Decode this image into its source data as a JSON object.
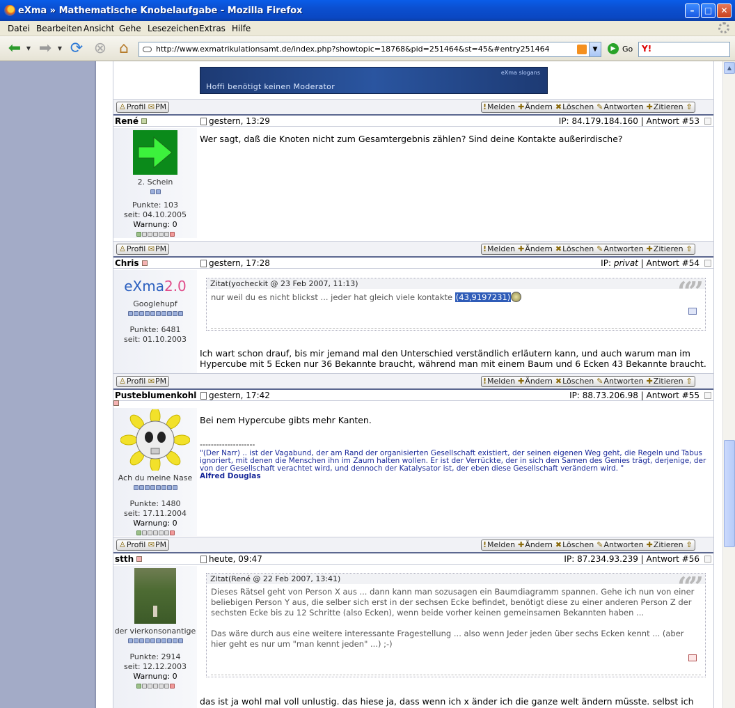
{
  "window": {
    "title": "eXma » Mathematische Knobelaufgabe - Mozilla Firefox"
  },
  "menu": [
    "Datei",
    "Bearbeiten",
    "Ansicht",
    "Gehe",
    "Lesezeichen",
    "Extras",
    "Hilfe"
  ],
  "nav": {
    "url": "http://www.exmatrikulationsamt.de/index.php?showtopic=18768&pid=251464&st=45&#entry251464",
    "go_label": "Go"
  },
  "banner": {
    "tag": "eXma slogans",
    "slogan": "Hoffi benötigt keinen Moderator"
  },
  "buttons": {
    "profil": "Profil",
    "pm": "PM",
    "melden": "Melden",
    "aendern": "Ändern",
    "loeschen": "Löschen",
    "antworten": "Antworten",
    "zitieren": "Zitieren"
  },
  "posts": [
    {
      "author": "René",
      "date": "gestern, 13:29",
      "ip_label": "IP:",
      "ip": "84.179.184.160",
      "answer": "Antwort #53",
      "rank": "2. Schein",
      "points": "Punkte: 103",
      "since": "seit: 04.10.2005",
      "warning": "Warnung: 0",
      "text": "Wer sagt, daß die Knoten nicht zum Gesamtergebnis zählen? Sind deine Kontakte außerirdische?"
    },
    {
      "author": "Chris",
      "date": "gestern, 17:28",
      "ip_label": "IP:",
      "ip": "privat",
      "answer": "Antwort #54",
      "logo_a": "eXma",
      "logo_b": "2.0",
      "rank": "Googlehupf",
      "points": "Punkte: 6481",
      "since": "seit: 01.10.2003",
      "quote_head": "Zitat(yocheckit @ 23 Feb 2007, 11:13)",
      "quote_text": "nur weil du es nicht blickst ... jeder hat gleich viele kontakte",
      "quote_highlight": "(43,9197231)",
      "text": "Ich wart schon drauf, bis mir jemand mal den Unterschied verständlich erläutern kann, und auch warum man im Hypercube mit 5 Ecken nur 36 Bekannte braucht, während man mit einem Baum und 6 Ecken 43 Bekannte braucht."
    },
    {
      "author": "Pusteblumenkohl",
      "date": "gestern, 17:42",
      "ip_label": "IP:",
      "ip": "88.73.206.98",
      "answer": "Antwort #55",
      "rank": "Ach du meine Nase",
      "points": "Punkte: 1480",
      "since": "seit: 17.11.2004",
      "warning": "Warnung: 0",
      "text": "Bei nem Hypercube gibts mehr Kanten.",
      "sig_sep": "--------------------",
      "sig_text": "\"(Der Narr) .. ist der Vagabund, der am Rand der organisierten Gesellschaft existiert, der seinen eigenen Weg geht, die Regeln und Tabus ignoriert, mit denen die Menschen ihn im Zaum halten wollen. Er ist der Verrückte, der in sich den Samen des Genies trägt, derjenige, der von der Gesellschaft verachtet wird, und dennoch der Katalysator ist, der eben diese Gesellschaft verändern wird. \"",
      "sig_author": "Alfred Douglas"
    },
    {
      "author": "stth",
      "date": "heute, 09:47",
      "ip_label": "IP:",
      "ip": "87.234.93.239",
      "answer": "Antwort #56",
      "rank": "der vierkonsonantige",
      "points": "Punkte: 2914",
      "since": "seit: 12.12.2003",
      "warning": "Warnung: 0",
      "quote_head": "Zitat(René @ 22 Feb 2007, 13:41)",
      "quote_p1": "Dieses Rätsel geht von Person X aus ... dann kann man sozusagen ein Baumdiagramm spannen. Gehe ich nun von einer beliebigen Person Y aus, die selber sich erst in der sechsen Ecke befindet, benötigt diese zu einer anderen Person Z der sechsten Ecke bis zu 12 Schritte (also Ecken), wenn beide vorher keinen gemeinsamen Bekannten haben ...",
      "quote_p2": "Das wäre durch aus eine weitere interessante Fragestellung ... also wenn Jeder jeden über sechs Ecken kennt ... (aber hier geht es nur um \"man kennt jeden\" ...) ;-)",
      "text": "das ist ja wohl mal voll unlustig. das hiese ja, dass wenn ich x änder ich die ganze welt ändern müsste. selbst ich"
    }
  ]
}
